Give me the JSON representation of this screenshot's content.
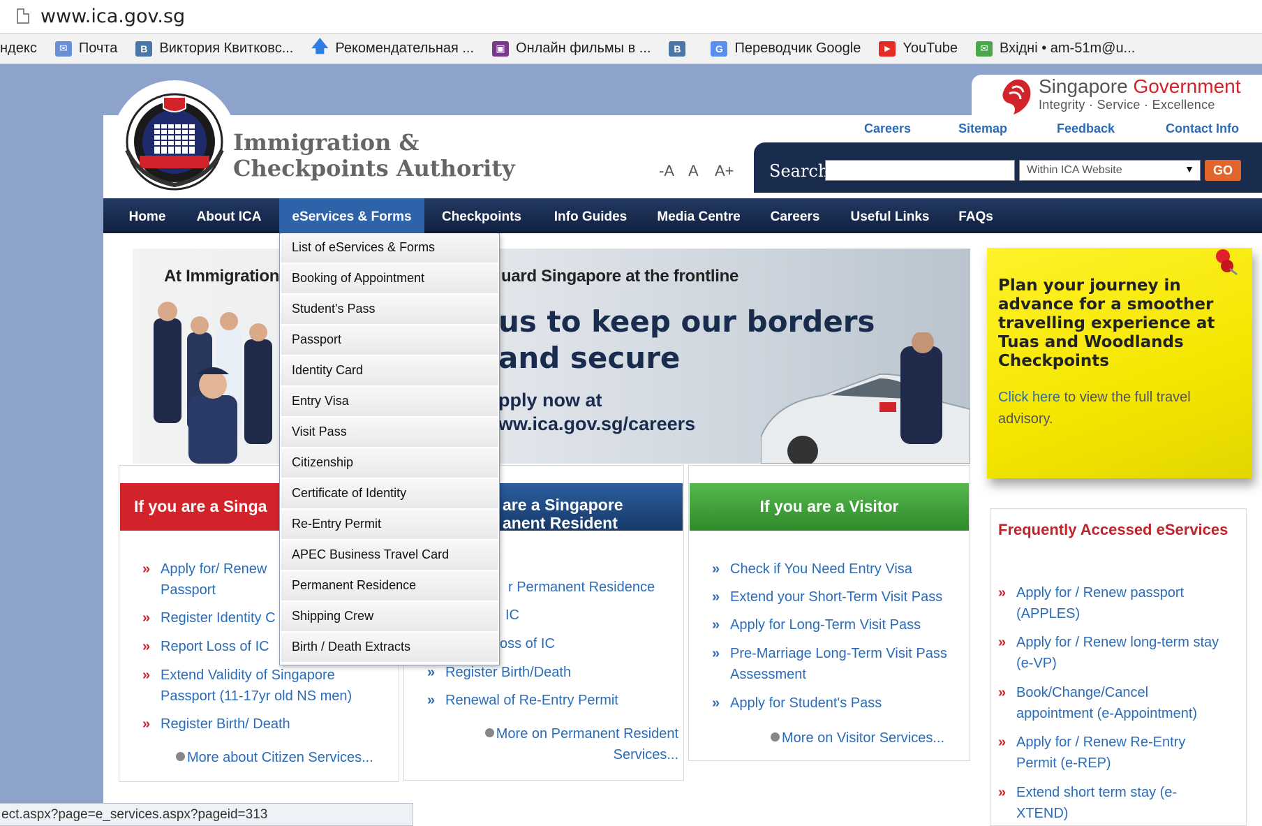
{
  "browser": {
    "url": "www.ica.gov.sg",
    "bookmarks": [
      {
        "label": "ндекс",
        "icon": "none",
        "color": ""
      },
      {
        "label": "Почта",
        "icon": "mail-icon",
        "color": "#6a8fd6"
      },
      {
        "label": "Виктория Квитковс...",
        "icon": "vk-icon",
        "color": "#4a76a8"
      },
      {
        "label": "Рекомендательная ...",
        "icon": "arrow-up-icon",
        "color": "#2f7de1"
      },
      {
        "label": "Онлайн фильмы в ...",
        "icon": "film-icon",
        "color": "#7a3a8a"
      },
      {
        "label": "",
        "icon": "vk-icon",
        "color": "#4a76a8"
      },
      {
        "label": "Переводчик Google",
        "icon": "google-translate-icon",
        "color": "#5b8ef0"
      },
      {
        "label": "YouTube",
        "icon": "youtube-icon",
        "color": "#e52d27"
      },
      {
        "label": "Вхідні • am-51m@u...",
        "icon": "inbox-icon",
        "color": "#4aa84a"
      }
    ],
    "status_url": "ect.aspx?page=e_services.aspx?pageid=313"
  },
  "gov": {
    "title_a": "Singapore ",
    "title_b": "Government",
    "tagline": "Integrity · Service · Excellence"
  },
  "header": {
    "name_line1": "Immigration &",
    "name_line2": "Checkpoints Authority",
    "top_links": [
      "Careers",
      "Sitemap",
      "Feedback",
      "Contact Info"
    ],
    "font_sizes": [
      "-A",
      "A",
      "A+"
    ],
    "search_label": "Search",
    "search_value": "",
    "search_scope": "Within ICA Website",
    "go_label": "GO"
  },
  "nav": [
    "Home",
    "About ICA",
    "eServices & Forms",
    "Checkpoints",
    "Info Guides",
    "Media Centre",
    "Careers",
    "Useful Links",
    "FAQs"
  ],
  "dropdown": [
    "List of eServices & Forms",
    "Booking of Appointment",
    "Student's Pass",
    "Passport",
    "Identity Card",
    "Entry Visa",
    "Visit Pass",
    "Citizenship",
    "Certificate of Identity",
    "Re-Entry Permit",
    "APEC Business Travel Card",
    "Permanent Residence",
    "Shipping Crew",
    "Birth / Death Extracts"
  ],
  "banner": {
    "line1_left": "At Immigration &",
    "line1_right": "uard Singapore at the frontline",
    "big1": "us to keep our borders",
    "big2": "and secure",
    "apply": "pply now at",
    "url": "ww.ica.gov.sg/careers"
  },
  "sticky": {
    "title": "Plan your journey in advance for a smoother travelling experience at Tuas and Woodlands Checkpoints",
    "link": "Click here",
    "text": " to view the full travel advisory."
  },
  "citizen": {
    "head": "If you are a Singa",
    "items": [
      "Apply for/ Renew",
      "Passport",
      "Register Identity C",
      "Report Loss of IC",
      "Extend Validity of Singapore",
      "Passport (11-17yr old NS men)",
      "Register Birth/ Death"
    ],
    "more": "More about Citizen Services..."
  },
  "pr": {
    "head1": "are a Singapore",
    "head2": "anent Resident",
    "items": [
      "r Permanent Residence",
      "IC",
      "oss of IC",
      "Register Birth/Death",
      "Renewal of Re-Entry Permit"
    ],
    "more1": "More on Permanent Resident",
    "more2": "Services..."
  },
  "visitor": {
    "head": "If you are a Visitor",
    "items": [
      "Check if You Need Entry Visa",
      "Extend your Short-Term Visit Pass",
      "Apply for Long-Term Visit Pass",
      "Pre-Marriage Long-Term Visit Pass",
      "Assessment",
      "Apply for Student's Pass"
    ],
    "more": "More on Visitor Services..."
  },
  "frequent": {
    "title": "Frequently Accessed eServices",
    "items": [
      "Apply for / Renew passport",
      "(APPLES)",
      "Apply for / Renew long-term stay",
      "(e-VP)",
      "Book/Change/Cancel",
      "appointment (e-Appointment)",
      "Apply for / Renew Re-Entry",
      "Permit (e-REP)",
      "Extend short term stay (e-",
      "XTEND)"
    ]
  },
  "colors": {
    "nav_bg": "#101f3e",
    "nav_active": "#2e63a9",
    "citizen_red": "#d2232a",
    "pr_blue": "#1d4b86",
    "visitor_green": "#3fa33a",
    "link_blue": "#2b6cb8"
  }
}
